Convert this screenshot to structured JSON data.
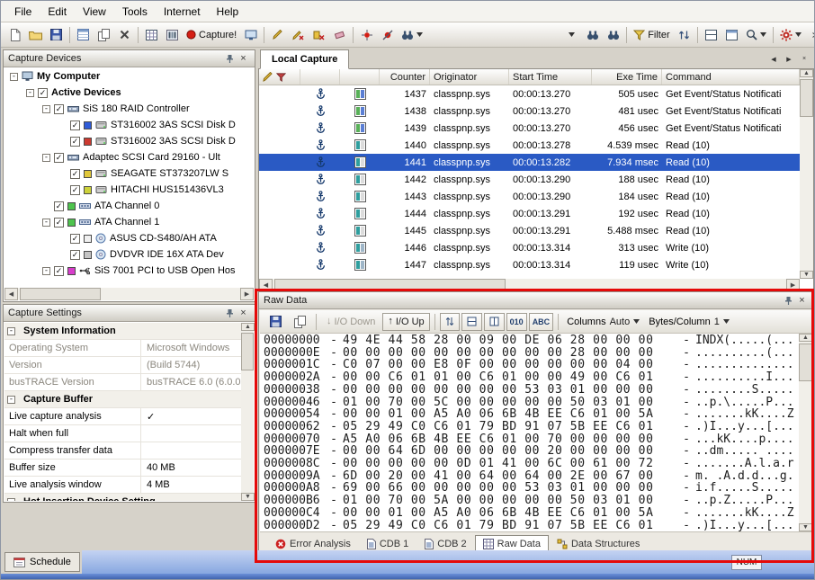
{
  "menu": {
    "items": [
      "File",
      "Edit",
      "View",
      "Tools",
      "Internet",
      "Help"
    ]
  },
  "toolbar": {
    "capture_label": "Capture!",
    "filter_label": "Filter"
  },
  "capture_devices": {
    "title": "Capture Devices",
    "tree": [
      {
        "label": "My Computer",
        "level": 0,
        "bold": true,
        "expander": "minus",
        "checkbox": null,
        "chip": null,
        "icon": "computer-icon"
      },
      {
        "label": "Active Devices",
        "level": 1,
        "bold": true,
        "expander": "minus",
        "checkbox": "checked",
        "chip": null,
        "icon": null
      },
      {
        "label": "SiS 180 RAID Controller",
        "level": 2,
        "bold": false,
        "expander": "minus",
        "checkbox": "checked",
        "chip": null,
        "icon": "controller-icon"
      },
      {
        "label": "ST316002 3AS SCSI Disk D",
        "level": 3,
        "bold": false,
        "expander": null,
        "checkbox": "checked",
        "chip": "#2e5bd8",
        "icon": "disk-icon"
      },
      {
        "label": "ST316002 3AS SCSI Disk D",
        "level": 3,
        "bold": false,
        "expander": null,
        "checkbox": "checked",
        "chip": "#cc3a30",
        "icon": "disk-icon"
      },
      {
        "label": "Adaptec SCSI Card 29160 - Ult",
        "level": 2,
        "bold": false,
        "expander": "minus",
        "checkbox": "checked",
        "chip": null,
        "icon": "controller-icon"
      },
      {
        "label": "SEAGATE ST373207LW S",
        "level": 3,
        "bold": false,
        "expander": null,
        "checkbox": "checked",
        "chip": "#e0c73a",
        "icon": "disk-icon"
      },
      {
        "label": "HITACHI HUS151436VL3",
        "level": 3,
        "bold": false,
        "expander": null,
        "checkbox": "checked",
        "chip": "#cdd23a",
        "icon": "disk-icon"
      },
      {
        "label": "ATA Channel 0",
        "level": 2,
        "bold": false,
        "expander": null,
        "checkbox": "checked",
        "chip": "#4ec44e",
        "icon": "channel-icon"
      },
      {
        "label": "ATA Channel 1",
        "level": 2,
        "bold": false,
        "expander": "minus",
        "checkbox": "checked",
        "chip": "#4ec44e",
        "icon": "channel-icon"
      },
      {
        "label": "ASUS CD-S480/AH ATA",
        "level": 3,
        "bold": false,
        "expander": null,
        "checkbox": "checked",
        "chip": "#f0f0f0",
        "icon": "cd-icon"
      },
      {
        "label": "DVDVR IDE 16X ATA Dev",
        "level": 3,
        "bold": false,
        "expander": null,
        "checkbox": "checked",
        "chip": "#c4c4c4",
        "icon": "cd-icon"
      },
      {
        "label": "SiS 7001 PCI to USB Open Hos",
        "level": 2,
        "bold": false,
        "expander": "minus",
        "checkbox": "checked",
        "chip": "#d83ecb",
        "icon": "usb-icon"
      }
    ]
  },
  "capture_settings": {
    "title": "Capture Settings",
    "rows": [
      {
        "type": "section",
        "label": "System Information"
      },
      {
        "type": "item",
        "label": "Operating System",
        "value": "Microsoft Windows",
        "muted": true
      },
      {
        "type": "item",
        "label": "Version",
        "value": "(Build 5744)",
        "muted": true
      },
      {
        "type": "item",
        "label": "busTRACE Version",
        "value": "busTRACE 6.0 (6.0.0",
        "muted": true
      },
      {
        "type": "section",
        "label": "Capture Buffer"
      },
      {
        "type": "item",
        "label": "Live capture analysis",
        "value": "✓",
        "muted": false
      },
      {
        "type": "item",
        "label": "Halt when full",
        "value": "",
        "muted": false
      },
      {
        "type": "item",
        "label": "Compress transfer data",
        "value": "",
        "muted": false
      },
      {
        "type": "item",
        "label": "Buffer size",
        "value": "40 MB",
        "muted": false
      },
      {
        "type": "item",
        "label": "Live analysis window",
        "value": "4 MB",
        "muted": false
      },
      {
        "type": "section",
        "label": "Hot Insertion Device Setting"
      }
    ]
  },
  "local_capture": {
    "tab_label": "Local Capture",
    "columns": {
      "counter": "Counter",
      "originator": "Originator",
      "start_time": "Start Time",
      "exe_time": "Exe Time",
      "command": "Command"
    },
    "rows": [
      {
        "counter": "1437",
        "originator": "classpnp.sys",
        "start_time": "00:00:13.270",
        "exe_time": "505 usec",
        "command": "Get Event/Status Notificati",
        "dir": "status",
        "selected": false
      },
      {
        "counter": "1438",
        "originator": "classpnp.sys",
        "start_time": "00:00:13.270",
        "exe_time": "481 usec",
        "command": "Get Event/Status Notificati",
        "dir": "status",
        "selected": false
      },
      {
        "counter": "1439",
        "originator": "classpnp.sys",
        "start_time": "00:00:13.270",
        "exe_time": "456 usec",
        "command": "Get Event/Status Notificati",
        "dir": "status",
        "selected": false
      },
      {
        "counter": "1440",
        "originator": "classpnp.sys",
        "start_time": "00:00:13.278",
        "exe_time": "4.539 msec",
        "command": "Read (10)",
        "dir": "read",
        "selected": false
      },
      {
        "counter": "1441",
        "originator": "classpnp.sys",
        "start_time": "00:00:13.282",
        "exe_time": "7.934 msec",
        "command": "Read (10)",
        "dir": "read",
        "selected": true
      },
      {
        "counter": "1442",
        "originator": "classpnp.sys",
        "start_time": "00:00:13.290",
        "exe_time": "188 usec",
        "command": "Read (10)",
        "dir": "read",
        "selected": false
      },
      {
        "counter": "1443",
        "originator": "classpnp.sys",
        "start_time": "00:00:13.290",
        "exe_time": "184 usec",
        "command": "Read (10)",
        "dir": "read",
        "selected": false
      },
      {
        "counter": "1444",
        "originator": "classpnp.sys",
        "start_time": "00:00:13.291",
        "exe_time": "192 usec",
        "command": "Read (10)",
        "dir": "read",
        "selected": false
      },
      {
        "counter": "1445",
        "originator": "classpnp.sys",
        "start_time": "00:00:13.291",
        "exe_time": "5.488 msec",
        "command": "Read (10)",
        "dir": "read",
        "selected": false
      },
      {
        "counter": "1446",
        "originator": "classpnp.sys",
        "start_time": "00:00:13.314",
        "exe_time": "313 usec",
        "command": "Write (10)",
        "dir": "write",
        "selected": false
      },
      {
        "counter": "1447",
        "originator": "classpnp.sys",
        "start_time": "00:00:13.314",
        "exe_time": "119 usec",
        "command": "Write (10)",
        "dir": "write",
        "selected": false
      }
    ]
  },
  "raw_data": {
    "title": "Raw Data",
    "toolbar": {
      "io_down_label": "I/O Down",
      "io_up_label": "I/O Up",
      "binary_label": "010",
      "ascii_label": "ABC",
      "columns_label": "Columns",
      "columns_value": "Auto",
      "bytes_label": "Bytes/Column",
      "bytes_value": "1"
    },
    "lines": [
      {
        "addr": "00000000",
        "hex": "49 4E 44 58 28 00 09 00 DE 06 28 00 00 00",
        "ascii": "INDX(.....(..."
      },
      {
        "addr": "0000000E",
        "hex": "00 00 00 00 00 00 00 00 00 00 28 00 00 00",
        "ascii": "..........(..."
      },
      {
        "addr": "0000001C",
        "hex": "C0 07 00 00 E8 0F 00 00 00 00 00 00 04 00",
        "ascii": ".............."
      },
      {
        "addr": "0000002A",
        "hex": "00 00 C6 01 01 00 C6 01 00 00 49 00 C6 01",
        "ascii": "..........I..."
      },
      {
        "addr": "00000038",
        "hex": "00 00 00 00 00 00 00 00 53 03 01 00 00 00",
        "ascii": "........S....."
      },
      {
        "addr": "00000046",
        "hex": "01 00 70 00 5C 00 00 00 00 00 50 03 01 00",
        "ascii": "..p.\\.....P..."
      },
      {
        "addr": "00000054",
        "hex": "00 00 01 00 A5 A0 06 6B 4B EE C6 01 00 5A",
        "ascii": ".......kK....Z"
      },
      {
        "addr": "00000062",
        "hex": "05 29 49 C0 C6 01 79 BD 91 07 5B EE C6 01",
        "ascii": ".)I...y...[..."
      },
      {
        "addr": "00000070",
        "hex": "A5 A0 06 6B 4B EE C6 01 00 70 00 00 00 00",
        "ascii": "...kK....p...."
      },
      {
        "addr": "0000007E",
        "hex": "00 00 64 6D 00 00 00 00 00 20 00 00 00 00",
        "ascii": "..dm..... ...."
      },
      {
        "addr": "0000008C",
        "hex": "00 00 00 00 00 0D 01 41 00 6C 00 61 00 72",
        "ascii": ".......A.l.a.r"
      },
      {
        "addr": "0000009A",
        "hex": "6D 00 20 00 41 00 64 00 64 00 2E 00 67 00",
        "ascii": "m. .A.d.d...g."
      },
      {
        "addr": "000000A8",
        "hex": "69 00 66 00 00 00 00 00 53 03 01 00 00 00",
        "ascii": "i.f.....S....."
      },
      {
        "addr": "000000B6",
        "hex": "01 00 70 00 5A 00 00 00 00 00 50 03 01 00",
        "ascii": "..p.Z.....P..."
      },
      {
        "addr": "000000C4",
        "hex": "00 00 01 00 A5 A0 06 6B 4B EE C6 01 00 5A",
        "ascii": ".......kK....Z"
      },
      {
        "addr": "000000D2",
        "hex": "05 29 49 C0 C6 01 79 BD 91 07 5B EE C6 01",
        "ascii": ".)I...y...[..."
      }
    ],
    "tabs": [
      {
        "label": "Error Analysis",
        "icon": "error-icon",
        "selected": false
      },
      {
        "label": "CDB 1",
        "icon": "cdb-icon",
        "selected": false
      },
      {
        "label": "CDB 2",
        "icon": "cdb-icon",
        "selected": false
      },
      {
        "label": "Raw Data",
        "icon": "rawdata-grid-icon",
        "selected": true
      },
      {
        "label": "Data Structures",
        "icon": "structures-icon",
        "selected": false
      }
    ]
  },
  "statusbar": {
    "schedule_label": "Schedule",
    "num": "NUM"
  }
}
